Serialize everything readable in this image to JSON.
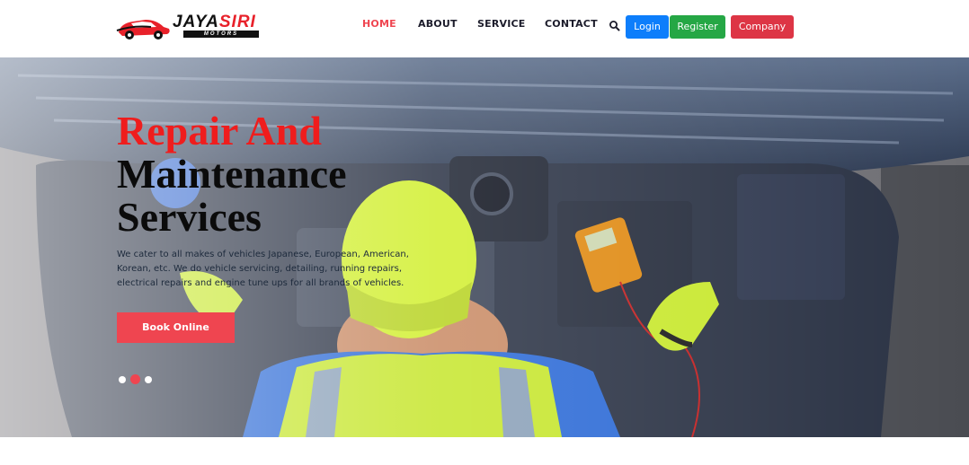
{
  "brand": {
    "name_part1": "JAYA",
    "name_part2": "SIRI",
    "subtitle": "MOTORS"
  },
  "nav": {
    "items": [
      {
        "label": "HOME",
        "active": true
      },
      {
        "label": "ABOUT",
        "active": false
      },
      {
        "label": "SERVICE",
        "active": false
      },
      {
        "label": "CONTACT",
        "active": false
      }
    ],
    "search_icon": "search-icon"
  },
  "auth": {
    "login_label": "Login",
    "register_label": "Register",
    "company_label": "Company"
  },
  "hero": {
    "title_line1": "Repair And",
    "title_line2": "Maintenance",
    "title_line3": "Services",
    "description": "We cater to all makes of vehicles Japanese, European, American, Korean, etc. We do vehicle servicing, detailing, running repairs, electrical repairs and engine tune ups for all brands of vehicles.",
    "cta_label": "Book Online",
    "slides": 3,
    "active_slide": 2
  },
  "colors": {
    "accent": "#ef4550",
    "login": "#0d7efb",
    "register": "#25a745",
    "company": "#dd3545",
    "title_red": "#ef1d1d"
  }
}
